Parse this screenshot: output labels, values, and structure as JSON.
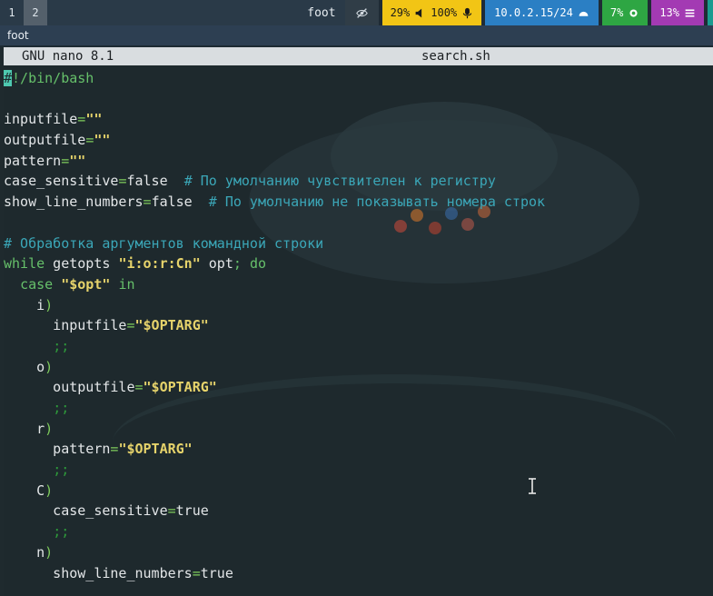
{
  "taskbar": {
    "workspaces": [
      "1",
      "2"
    ],
    "active_workspace": "2",
    "window_title": "foot",
    "idle_icon": "eye-slash-icon",
    "audio": {
      "battery": "29%",
      "speaker_icon": "speaker-icon",
      "volume": "100%",
      "mic_icon": "microphone-icon"
    },
    "network": {
      "address": "10.0.2.15/24",
      "icon": "wifi-icon"
    },
    "cpu": {
      "value": "7%",
      "icon": "cpu-icon"
    },
    "memory": {
      "value": "13%",
      "icon": "menu-icon"
    },
    "colors": {
      "audio": "#f2c515",
      "network": "#2b7fc4",
      "cpu": "#2ea643",
      "memory": "#a33ab3"
    }
  },
  "window": {
    "title": "foot"
  },
  "nano": {
    "version": "GNU nano 8.1",
    "filename": "search.sh"
  },
  "code_lines": [
    "#!/bin/bash",
    "",
    "inputfile=\"\"",
    "outputfile=\"\"",
    "pattern=\"\"",
    "case_sensitive=false  # По умолчанию чувствителен к регистру",
    "show_line_numbers=false  # По умолчанию не показывать номера строк",
    "",
    "# Обработка аргументов командной строки",
    "while getopts \"i:o:r:Cn\" opt; do",
    "  case \"$opt\" in",
    "    i)",
    "      inputfile=\"$OPTARG\"",
    "      ;;",
    "    o)",
    "      outputfile=\"$OPTARG\"",
    "      ;;",
    "    r)",
    "      pattern=\"$OPTARG\"",
    "      ;;",
    "    C)",
    "      case_sensitive=true",
    "      ;;",
    "    n)",
    "      show_line_numbers=true"
  ]
}
